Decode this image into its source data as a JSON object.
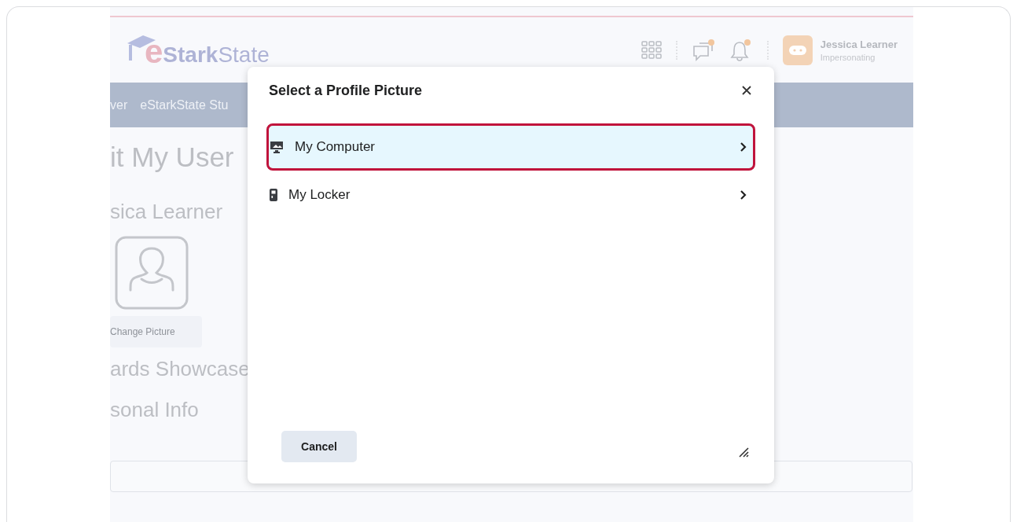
{
  "header": {
    "logo": {
      "letter": "e",
      "bold": "Stark",
      "rest": "State"
    },
    "user": {
      "name": "Jessica Learner",
      "role": "Impersonating"
    }
  },
  "nav": [
    "ver",
    "eStarkState Stu"
  ],
  "page": {
    "heading": "it My User",
    "name": "sica Learner",
    "change_button": "Change Picture",
    "sections": [
      "ards Showcase",
      "sonal Info"
    ]
  },
  "dialog": {
    "title": "Select a Profile Picture",
    "options": [
      {
        "label": "My Computer",
        "kind": "computer",
        "selected": true
      },
      {
        "label": "My Locker",
        "kind": "locker",
        "selected": false
      }
    ],
    "cancel": "Cancel"
  }
}
